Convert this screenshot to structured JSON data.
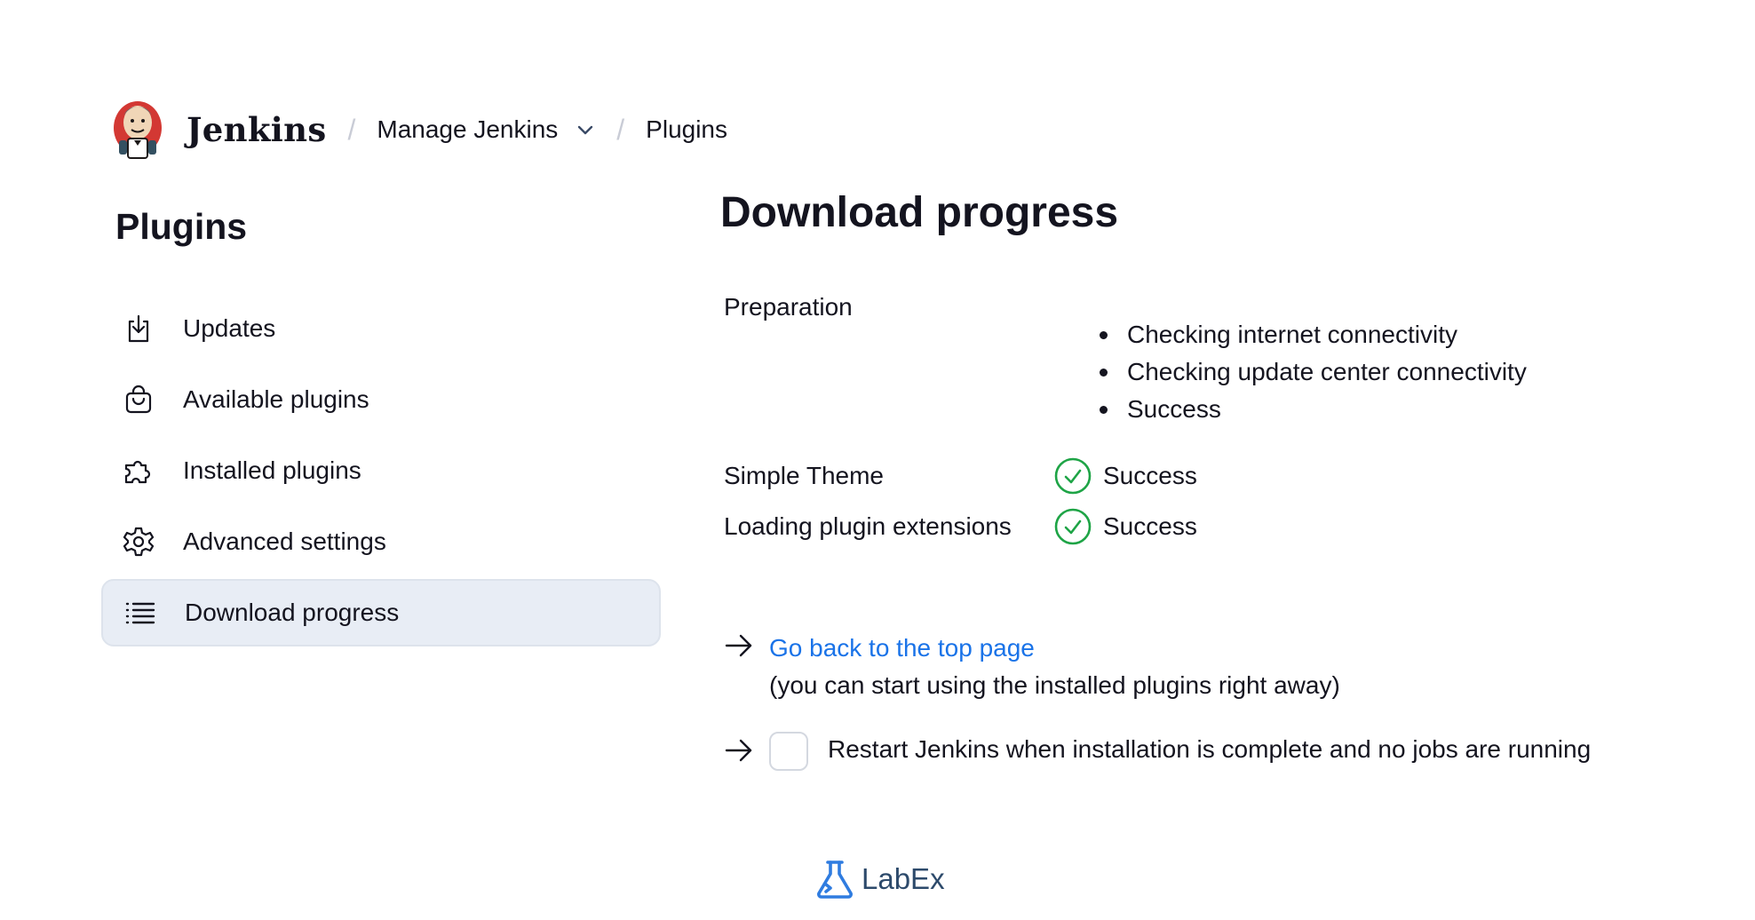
{
  "header": {
    "brand": "Jenkins",
    "breadcrumbs": [
      {
        "label": "Manage Jenkins"
      },
      {
        "label": "Plugins"
      }
    ]
  },
  "sidebar": {
    "title": "Plugins",
    "items": [
      {
        "label": "Updates",
        "icon": "download-icon"
      },
      {
        "label": "Available plugins",
        "icon": "shopping-bag-icon"
      },
      {
        "label": "Installed plugins",
        "icon": "puzzle-icon"
      },
      {
        "label": "Advanced settings",
        "icon": "gear-icon"
      },
      {
        "label": "Download progress",
        "icon": "list-icon",
        "active": true
      }
    ]
  },
  "main": {
    "title": "Download progress",
    "preparation": {
      "label": "Preparation",
      "steps": [
        "Checking internet connectivity",
        "Checking update center connectivity",
        "Success"
      ]
    },
    "plugins": [
      {
        "name": "Simple Theme",
        "status": "Success"
      },
      {
        "name": "Loading plugin extensions",
        "status": "Success"
      }
    ],
    "back_link": "Go back to the top page",
    "back_note": "(you can start using the installed plugins right away)",
    "restart_label": "Restart Jenkins when installation is complete and no jobs are running",
    "restart_checked": false
  },
  "footer": {
    "brand": "LabEx"
  },
  "colors": {
    "link": "#1a73e8",
    "success": "#1ea446",
    "active_bg": "#e8edf5"
  }
}
